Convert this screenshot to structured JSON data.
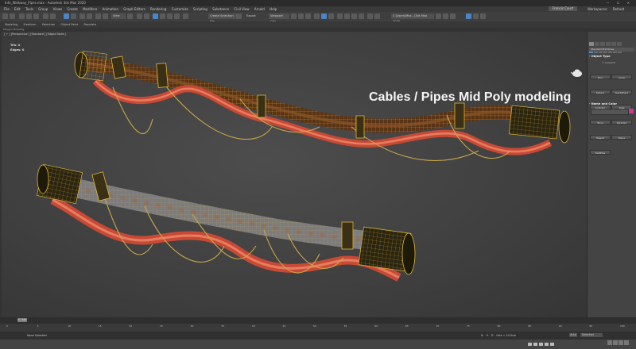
{
  "window": {
    "title": "Info_Walkway_Pipes.max - Autodesk 3ds Max 2020",
    "controls": "— ☐ ✕"
  },
  "menu": [
    "File",
    "Edit",
    "Tools",
    "Group",
    "Views",
    "Create",
    "Modifiers",
    "Animation",
    "Graph Editors",
    "Rendering",
    "Customize",
    "Scripting",
    "Substance",
    "Civil View",
    "Arnold",
    "Help"
  ],
  "account": {
    "sign_in": "Francis Court",
    "workspaces_label": "Workspaces:",
    "workspace": "Default"
  },
  "toolbar": {
    "view_dropdown": "View",
    "selection_set": "Create Selection Set",
    "export_label": "Export",
    "render_dd": "Viewport Clip",
    "path_dd": "C:\\Users\\Max...\\3ds Max 2020"
  },
  "ribbon": {
    "tabs": [
      "Modeling",
      "Freeform",
      "Selection",
      "Object Paint",
      "Populate"
    ],
    "sub": "Polygon Modeling"
  },
  "viewport": {
    "label": "[ + ] [Perspective ] [Standard ] [Edged Faces ]",
    "stats_tris_label": "Tris:",
    "stats_tris_value": "0",
    "stats_edges_label": "Edges:",
    "stats_edges_value": "0",
    "overlay_text": "Cables / Pipes Mid Poly modeling"
  },
  "command_panel": {
    "dropdown": "Standard Primitives",
    "object_type_header": "Object Type",
    "autogrid": "AutoGrid",
    "buttons": [
      "Box",
      "Cone",
      "Sphere",
      "GeoSphere",
      "Cylinder",
      "Tube",
      "Torus",
      "Pyramid",
      "Teapot",
      "Plane",
      "TextPlus"
    ],
    "name_color_header": "Name and Color",
    "color": "#d13a8a"
  },
  "timeline": {
    "slider": "0 / 100",
    "ticks": [
      "0",
      "5",
      "10",
      "15",
      "20",
      "25",
      "30",
      "35",
      "40",
      "45",
      "50",
      "55",
      "60",
      "65",
      "70",
      "75",
      "80",
      "85",
      "90",
      "95",
      "100"
    ]
  },
  "status": {
    "selection": "None Selected",
    "x_label": "X:",
    "y_label": "Y:",
    "z_label": "Z:",
    "grid": "Grid = 10.0cm",
    "autokey": "Auto",
    "selected_set": "Selected"
  }
}
